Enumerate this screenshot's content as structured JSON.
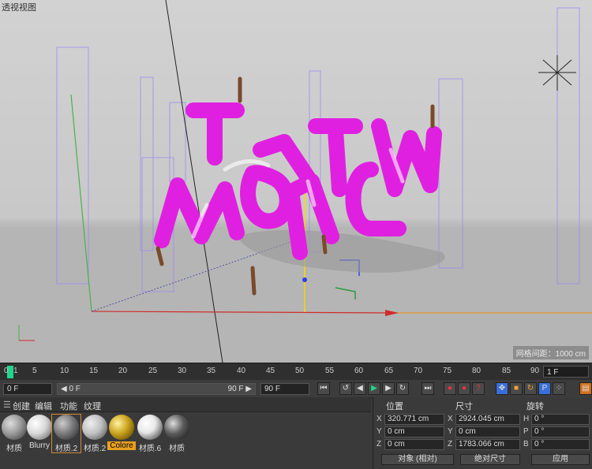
{
  "viewport": {
    "title": "透视视图",
    "grid_label": "网格间距：1000 cm"
  },
  "timeline": {
    "ticks": [
      "0",
      "5",
      "10",
      "15",
      "20",
      "25",
      "30",
      "35",
      "40",
      "45",
      "50",
      "55",
      "60",
      "65",
      "70",
      "75",
      "80",
      "85",
      "90"
    ],
    "current_frame_display": "1 F",
    "playhead_label": "1"
  },
  "transport": {
    "start_field": "0 F",
    "range_start": "◀ 0 F",
    "range_end": "90 F ▶",
    "end_field": "90 F"
  },
  "materials": {
    "menu": [
      "创建",
      "编辑",
      "功能",
      "纹理"
    ],
    "items": [
      {
        "label": "材质",
        "color": "#9a9a9a"
      },
      {
        "label": "Blurry",
        "color": "#d8d8d8"
      },
      {
        "label": "材质.2",
        "color": "#7a7a7a"
      },
      {
        "label": "材质.2",
        "color": "#c0c0c0"
      },
      {
        "label": "Colore",
        "color": "#c9a21c"
      },
      {
        "label": "材质.6",
        "color": "#e8e8e8"
      },
      {
        "label": "材质",
        "color": "#5c5c5c"
      }
    ]
  },
  "coords": {
    "headers": {
      "position": "位置",
      "size": "尺寸",
      "rotation": "旋转"
    },
    "rows": [
      {
        "axis": "X",
        "pos": "320.771 cm",
        "size_axis": "X",
        "size": "2924.045 cm",
        "rot_axis": "H",
        "rot": "0 °"
      },
      {
        "axis": "Y",
        "pos": "0 cm",
        "size_axis": "Y",
        "size": "0 cm",
        "rot_axis": "P",
        "rot": "0 °"
      },
      {
        "axis": "Z",
        "pos": "0 cm",
        "size_axis": "Z",
        "size": "1783.066 cm",
        "rot_axis": "B",
        "rot": "0 °"
      }
    ],
    "mode_dropdown": "对象 (相对)",
    "size_dropdown": "绝对尺寸",
    "apply_button": "应用"
  }
}
